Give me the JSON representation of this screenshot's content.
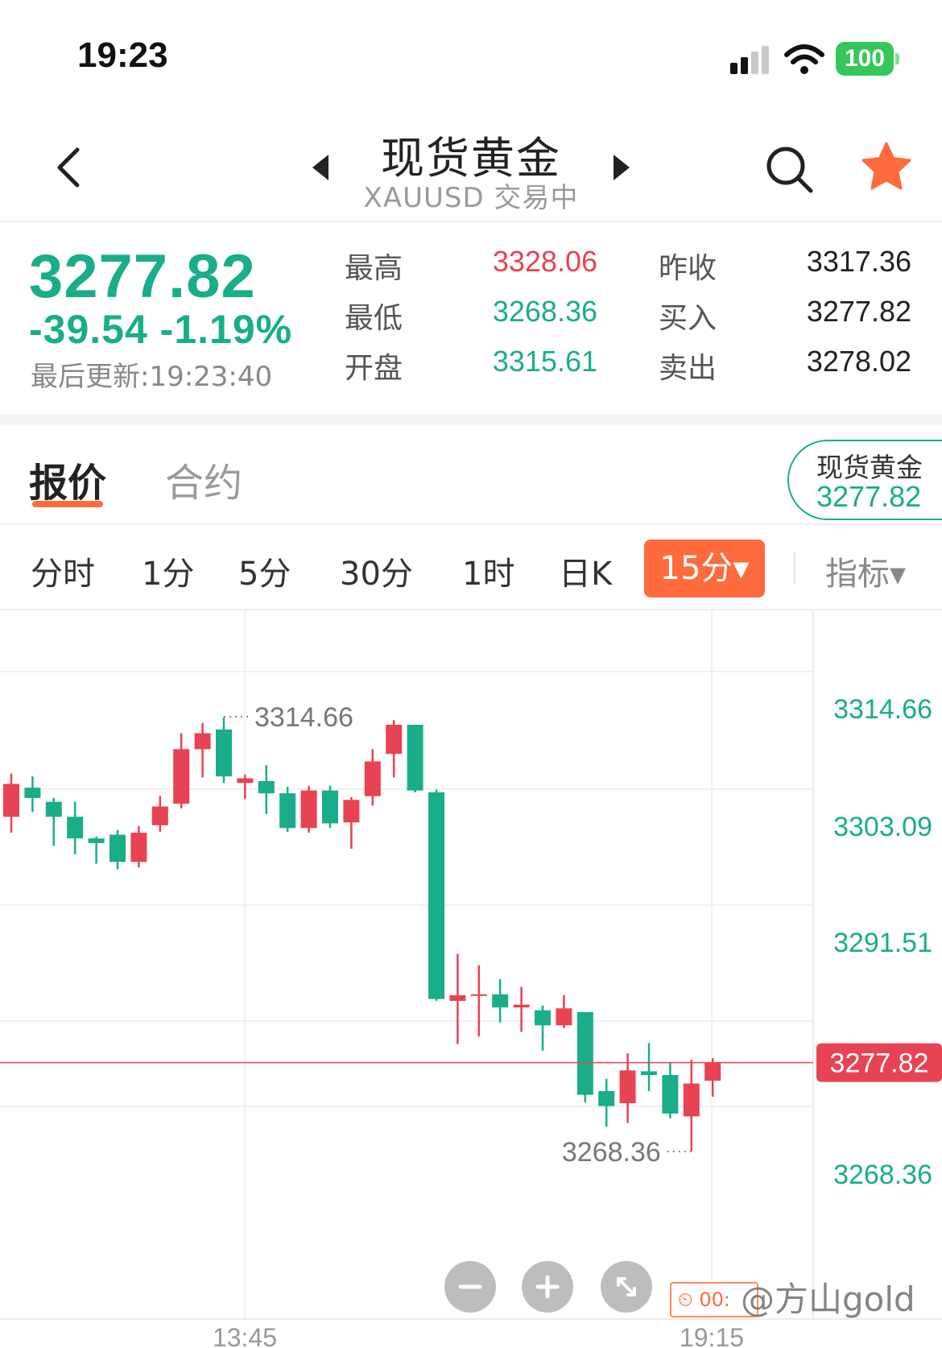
{
  "status_bar": {
    "time": "19:23",
    "battery": "100"
  },
  "header": {
    "title": "现货黄金",
    "subtitle": "XAUUSD 交易中"
  },
  "quote": {
    "last_price": "3277.82",
    "change": "-39.54  -1.19%",
    "updated": "最后更新:19:23:40",
    "stats": [
      {
        "label": "最高",
        "value": "3328.06",
        "color": "#e84352"
      },
      {
        "label": "最低",
        "value": "3268.36",
        "color": "#1aad8a"
      },
      {
        "label": "开盘",
        "value": "3315.61",
        "color": "#1aad8a"
      },
      {
        "label": "昨收",
        "value": "3317.36",
        "color": "#222222"
      },
      {
        "label": "买入",
        "value": "3277.82",
        "color": "#222222"
      },
      {
        "label": "卖出",
        "value": "3278.02",
        "color": "#222222"
      }
    ]
  },
  "tabs": {
    "quote": "报价",
    "contract": "合约",
    "ref_name": "现货黄金",
    "ref_price": "3277.82"
  },
  "periods": {
    "items": [
      "分时",
      "1分",
      "5分",
      "30分",
      "1时",
      "日K"
    ],
    "active": "15分▾",
    "indicator": "指标▾"
  },
  "colors": {
    "up": "#e84352",
    "down": "#1aad8a",
    "accent": "#ff6b3d"
  },
  "chart_data": {
    "type": "candlestick",
    "interval": "15分",
    "y_ticks": [
      "3314.66",
      "3303.09",
      "3291.51",
      "3268.36"
    ],
    "x_ticks": [
      "13:45",
      "19:15"
    ],
    "current_price_label": "3277.82",
    "high_label": "3314.66",
    "low_label": "3268.36",
    "candles": [
      {
        "o": 3304.0,
        "h": 3308.6,
        "l": 3302.3,
        "c": 3307.5
      },
      {
        "o": 3307.1,
        "h": 3308.3,
        "l": 3304.5,
        "c": 3306.0
      },
      {
        "o": 3305.6,
        "h": 3306.0,
        "l": 3300.9,
        "c": 3304.0
      },
      {
        "o": 3304.0,
        "h": 3305.6,
        "l": 3300.0,
        "c": 3301.7
      },
      {
        "o": 3301.7,
        "h": 3301.9,
        "l": 3299.0,
        "c": 3301.2
      },
      {
        "o": 3302.1,
        "h": 3302.6,
        "l": 3298.4,
        "c": 3299.2
      },
      {
        "o": 3299.2,
        "h": 3303.0,
        "l": 3298.6,
        "c": 3302.3
      },
      {
        "o": 3303.1,
        "h": 3306.2,
        "l": 3302.4,
        "c": 3305.1
      },
      {
        "o": 3305.4,
        "h": 3312.9,
        "l": 3304.9,
        "c": 3311.2
      },
      {
        "o": 3311.2,
        "h": 3314.0,
        "l": 3308.2,
        "c": 3312.9
      },
      {
        "o": 3313.3,
        "h": 3314.6,
        "l": 3307.6,
        "c": 3308.3
      },
      {
        "o": 3307.6,
        "h": 3308.5,
        "l": 3305.9,
        "c": 3308.1
      },
      {
        "o": 3307.8,
        "h": 3309.5,
        "l": 3304.3,
        "c": 3306.5
      },
      {
        "o": 3306.5,
        "h": 3307.2,
        "l": 3302.4,
        "c": 3302.8
      },
      {
        "o": 3302.8,
        "h": 3307.3,
        "l": 3302.3,
        "c": 3306.8
      },
      {
        "o": 3306.8,
        "h": 3307.3,
        "l": 3302.8,
        "c": 3303.3
      },
      {
        "o": 3303.4,
        "h": 3306.1,
        "l": 3300.6,
        "c": 3305.8
      },
      {
        "o": 3306.2,
        "h": 3311.2,
        "l": 3305.2,
        "c": 3309.9
      },
      {
        "o": 3310.7,
        "h": 3314.3,
        "l": 3308.2,
        "c": 3313.8
      },
      {
        "o": 3313.8,
        "h": 3313.8,
        "l": 3306.6,
        "c": 3306.8
      },
      {
        "o": 3306.6,
        "h": 3306.9,
        "l": 3284.4,
        "c": 3284.6
      },
      {
        "o": 3284.4,
        "h": 3289.4,
        "l": 3279.8,
        "c": 3285.0
      },
      {
        "o": 3285.0,
        "h": 3288.2,
        "l": 3280.6,
        "c": 3285.1
      },
      {
        "o": 3285.1,
        "h": 3286.7,
        "l": 3282.1,
        "c": 3283.7
      },
      {
        "o": 3283.7,
        "h": 3285.9,
        "l": 3281.1,
        "c": 3284.0
      },
      {
        "o": 3283.4,
        "h": 3283.9,
        "l": 3279.1,
        "c": 3281.8
      },
      {
        "o": 3281.8,
        "h": 3285.0,
        "l": 3281.5,
        "c": 3283.6
      },
      {
        "o": 3283.2,
        "h": 3283.2,
        "l": 3273.6,
        "c": 3274.4
      },
      {
        "o": 3274.8,
        "h": 3276.1,
        "l": 3271.0,
        "c": 3273.2
      },
      {
        "o": 3273.5,
        "h": 3278.8,
        "l": 3271.4,
        "c": 3277.0
      },
      {
        "o": 3276.9,
        "h": 3279.9,
        "l": 3274.8,
        "c": 3276.5
      },
      {
        "o": 3276.5,
        "h": 3277.9,
        "l": 3271.9,
        "c": 3272.4
      },
      {
        "o": 3272.1,
        "h": 3278.1,
        "l": 3268.4,
        "c": 3275.6
      },
      {
        "o": 3275.9,
        "h": 3278.3,
        "l": 3274.2,
        "c": 3277.8
      }
    ]
  },
  "controls": {
    "timer": "⏲ 00:",
    "watermark": "@方山gold"
  }
}
